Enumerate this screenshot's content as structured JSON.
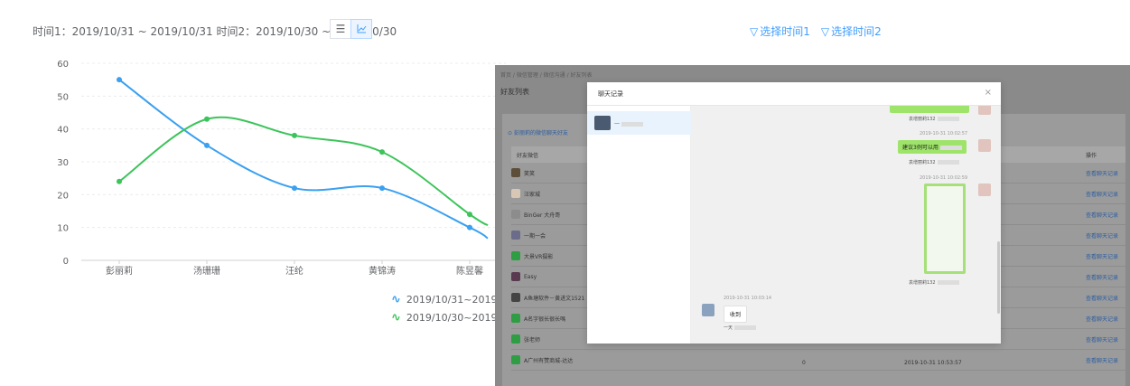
{
  "header": {
    "time_label": "时间1：2019/10/31 ~ 2019/10/31   时间2：2019/10/30 ~ 2019/10/30",
    "list_view_icon": "list-icon",
    "chart_view_icon": "line-chart-icon",
    "filter1": "选择时间1",
    "filter2": "选择时间2",
    "accent": "#409eff"
  },
  "chart_data": {
    "type": "line",
    "categories": [
      "彭丽莉",
      "汤珊珊",
      "汪纶",
      "黄锦涛",
      "陈昱馨"
    ],
    "ylim": [
      0,
      60
    ],
    "yticks": [
      "0",
      "10",
      "20",
      "30",
      "40",
      "50",
      "60"
    ],
    "grid": true,
    "legend_placement": "bottom",
    "series": [
      {
        "name": "2019/10/31~2019/10/31",
        "color": "#3aa0f0",
        "values": [
          55,
          35,
          22,
          22,
          10
        ]
      },
      {
        "name": "2019/10/30~2019/10/30",
        "color": "#3cc45a",
        "values": [
          24,
          43,
          38,
          33,
          14
        ]
      }
    ]
  },
  "screenshot": {
    "breadcrumb": "首页 / 微信管理 / 微信沟通 / 好友列表",
    "title": "好友列表",
    "subtitle": "彭丽莉的微信聊天好友",
    "col_friend": "好友微信",
    "col_op": "操作",
    "op_label": "查看聊天记录",
    "rows": [
      "笑笑",
      "汪家城",
      "BinGer 大舟哥",
      "一期一会",
      "大景VR摄影",
      "Easy",
      "A鱼塘软件－黄进文1521",
      "A名字很长很长嗎",
      "张老师",
      "A广州有赞商城-达达"
    ],
    "last_count": "0",
    "last_time": "2019-10-31 10:53:57"
  },
  "dialog": {
    "title": "聊天记录",
    "close": "×",
    "contact_name": "一",
    "sender_name": "袁增丽莉132",
    "time1": "2019-10-31 10:02:57",
    "msg1": "建议3例可以用",
    "time2": "2019-10-31 10:02:59",
    "time3": "2019-10-31 10:03:14",
    "reply": "收到",
    "reply_name": "一天"
  }
}
